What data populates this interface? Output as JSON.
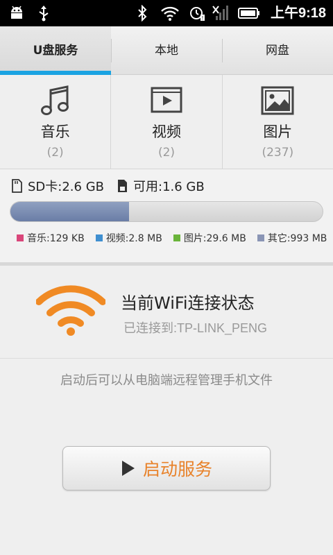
{
  "status_bar": {
    "time": "上午9:18",
    "icons": [
      "android-debug-icon",
      "usb-icon",
      "bluetooth-icon",
      "wifi-signal-icon",
      "alarm-icon",
      "signal-icon",
      "battery-icon"
    ]
  },
  "tabs": [
    {
      "label": "U盘服务",
      "active": true
    },
    {
      "label": "本地",
      "active": false
    },
    {
      "label": "网盘",
      "active": false
    }
  ],
  "categories": [
    {
      "label": "音乐",
      "count": "(2)",
      "icon": "music-note-icon"
    },
    {
      "label": "视频",
      "count": "(2)",
      "icon": "video-play-icon"
    },
    {
      "label": "图片",
      "count": "(237)",
      "icon": "picture-icon"
    }
  ],
  "storage": {
    "sd_label": "SD卡:2.6 GB",
    "available_label": "可用:1.6 GB",
    "used_fraction": 0.38,
    "legend": [
      {
        "label": "音乐:129 KB",
        "color": "#d9467a"
      },
      {
        "label": "视频:2.8 MB",
        "color": "#3f8fd0"
      },
      {
        "label": "图片:29.6 MB",
        "color": "#6ab43a"
      },
      {
        "label": "其它:993 MB",
        "color": "#8a95b5"
      }
    ]
  },
  "wifi": {
    "title": "当前WiFi连接状态",
    "status": "已连接到:TP-LINK_PENG",
    "accent": "#f08a24"
  },
  "hint": "启动后可以从电脑端远程管理手机文件",
  "start_button": {
    "label": "启动服务",
    "color": "#e8822a"
  }
}
